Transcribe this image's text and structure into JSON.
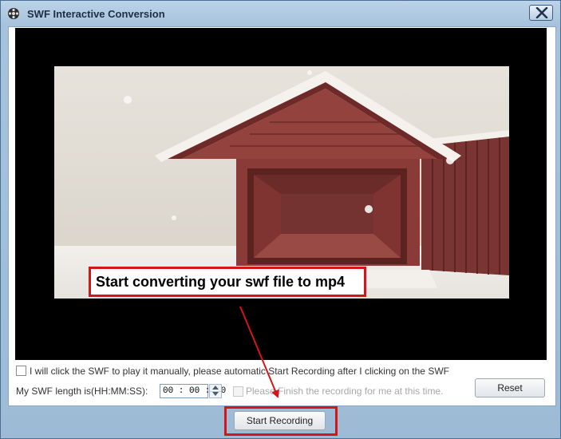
{
  "window": {
    "title": "SWF Interactive Conversion",
    "icons": {
      "app": "film-reel-icon",
      "close": "close-icon"
    }
  },
  "preview": {
    "overlay_text": "Start converting your swf file to mp4"
  },
  "options": {
    "manual_play_label": "I will click the SWF to play it manually, please automatic Start Recording after I clicking on the SWF",
    "manual_play_checked": false,
    "length_label": "My SWF length is(HH:MM:SS):",
    "length_value": "00 : 00 : 00",
    "finish_label": "Please Finish the recording for me at this time.",
    "finish_checked": false,
    "finish_enabled": false,
    "reset_label": "Reset"
  },
  "footer": {
    "start_recording_label": "Start Recording"
  },
  "colors": {
    "highlight": "#d4161b",
    "window_chrome": "#a7c3dc"
  }
}
